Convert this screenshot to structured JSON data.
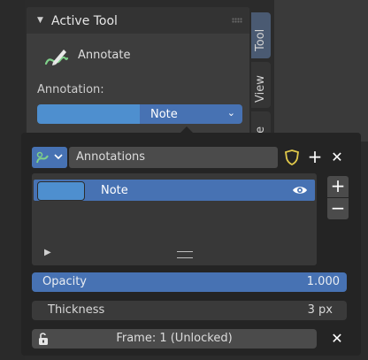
{
  "panel": {
    "title": "Active Tool",
    "tool_name": "Annotate",
    "annotation_label": "Annotation:",
    "annotation_value": "Note"
  },
  "tabs": [
    {
      "label": "Tool",
      "active": true
    },
    {
      "label": "View",
      "active": false
    },
    {
      "label": "ate",
      "active": false
    }
  ],
  "popover": {
    "header": {
      "data_name": "Annotations"
    },
    "layers": [
      {
        "name": "Note",
        "selected": true,
        "visible": true
      }
    ],
    "opacity": {
      "label": "Opacity",
      "value": "1.000"
    },
    "thickness": {
      "label": "Thickness",
      "value": "3 px"
    },
    "frame": {
      "text": "Frame: 1 (Unlocked)"
    }
  },
  "colors": {
    "accent": "#4772b3",
    "note_color": "#4e8fcf"
  }
}
